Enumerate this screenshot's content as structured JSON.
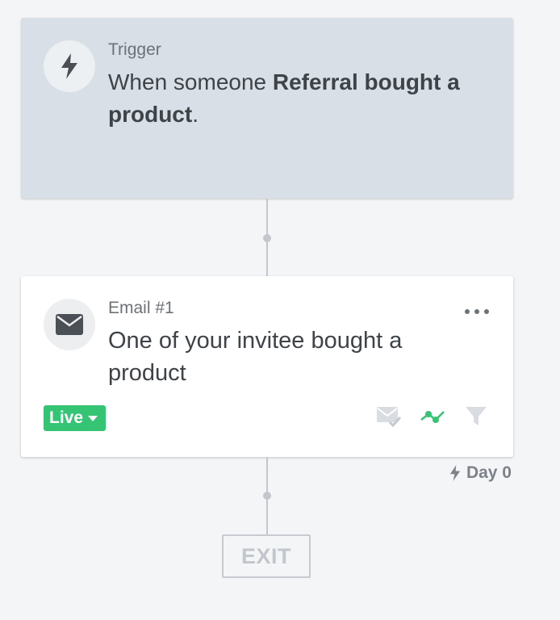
{
  "trigger": {
    "kicker": "Trigger",
    "text_prefix": "When someone ",
    "text_bold": "Referral bought a product",
    "text_suffix": ".",
    "icon": "lightning-icon"
  },
  "email": {
    "kicker": "Email #1",
    "title": "One of your invitee bought a product",
    "icon": "envelope-icon",
    "status": "Live",
    "status_color": "#35c374",
    "tools": [
      "email-check-icon",
      "trend-icon",
      "filter-icon"
    ]
  },
  "delay": {
    "label": "Day 0",
    "icon": "lightning-icon"
  },
  "exit": {
    "label": "EXIT"
  }
}
